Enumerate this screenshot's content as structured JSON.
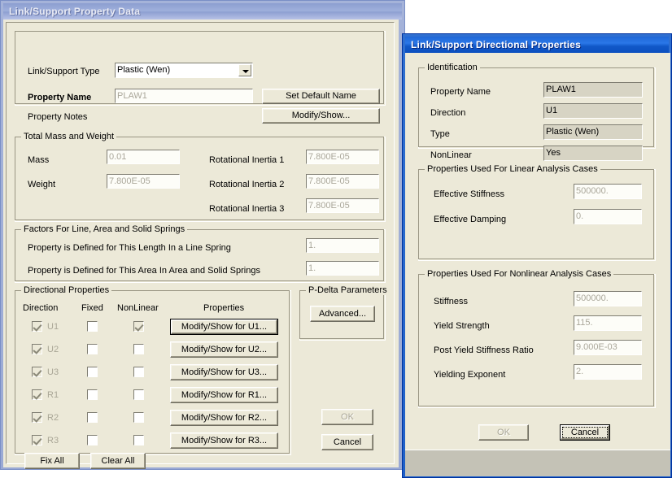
{
  "window_property_data": {
    "title": "Link/Support Property Data",
    "link_support_type": {
      "label": "Link/Support Type",
      "value": "Plastic (Wen)"
    },
    "property_name": {
      "label": "Property Name",
      "value": "PLAW1"
    },
    "property_notes": {
      "label": "Property Notes"
    },
    "set_default_name_button": "Set Default Name",
    "modify_show_notes_button": "Modify/Show...",
    "total_mass_and_weight": {
      "legend": "Total Mass and Weight",
      "mass": {
        "label": "Mass",
        "value": "0.01"
      },
      "weight": {
        "label": "Weight",
        "value": "7.800E-05"
      },
      "rotational_inertia_1": {
        "label": "Rotational Inertia 1",
        "value": "7.800E-05"
      },
      "rotational_inertia_2": {
        "label": "Rotational Inertia 2",
        "value": "7.800E-05"
      },
      "rotational_inertia_3": {
        "label": "Rotational Inertia 3",
        "value": "7.800E-05"
      }
    },
    "factors": {
      "legend": "Factors For Line, Area and Solid Springs",
      "line_spring": {
        "label": "Property is Defined for This Length In a Line Spring",
        "value": "1."
      },
      "area_solid_spring": {
        "label": "Property is Defined for This Area In Area and Solid Springs",
        "value": "1."
      }
    },
    "directional_properties": {
      "legend": "Directional Properties",
      "headers": {
        "direction": "Direction",
        "fixed": "Fixed",
        "nonlinear": "NonLinear",
        "properties": "Properties"
      },
      "rows": [
        {
          "direction": "U1",
          "direction_checked": true,
          "fixed_checked": false,
          "nonlinear_checked": true,
          "button": "Modify/Show for U1..."
        },
        {
          "direction": "U2",
          "direction_checked": true,
          "fixed_checked": false,
          "nonlinear_checked": false,
          "button": "Modify/Show for U2..."
        },
        {
          "direction": "U3",
          "direction_checked": true,
          "fixed_checked": false,
          "nonlinear_checked": false,
          "button": "Modify/Show for U3..."
        },
        {
          "direction": "R1",
          "direction_checked": true,
          "fixed_checked": false,
          "nonlinear_checked": false,
          "button": "Modify/Show for R1..."
        },
        {
          "direction": "R2",
          "direction_checked": true,
          "fixed_checked": false,
          "nonlinear_checked": false,
          "button": "Modify/Show for R2..."
        },
        {
          "direction": "R3",
          "direction_checked": true,
          "fixed_checked": false,
          "nonlinear_checked": false,
          "button": "Modify/Show for R3..."
        }
      ],
      "fix_all_button": "Fix All",
      "clear_all_button": "Clear All"
    },
    "p_delta": {
      "legend": "P-Delta Parameters",
      "advanced_button": "Advanced..."
    },
    "ok_button": "OK",
    "cancel_button": "Cancel"
  },
  "window_directional_properties": {
    "title": "Link/Support Directional Properties",
    "identification": {
      "legend": "Identification",
      "property_name": {
        "label": "Property Name",
        "value": "PLAW1"
      },
      "direction": {
        "label": "Direction",
        "value": "U1"
      },
      "type": {
        "label": "Type",
        "value": "Plastic (Wen)"
      },
      "nonlinear": {
        "label": "NonLinear",
        "value": "Yes"
      }
    },
    "linear_analysis": {
      "legend": "Properties Used For Linear Analysis Cases",
      "effective_stiffness": {
        "label": "Effective Stiffness",
        "value": "500000."
      },
      "effective_damping": {
        "label": "Effective Damping",
        "value": "0."
      }
    },
    "nonlinear_analysis": {
      "legend": "Properties Used For Nonlinear Analysis Cases",
      "stiffness": {
        "label": "Stiffness",
        "value": "500000."
      },
      "yield_strength": {
        "label": "Yield Strength",
        "value": "115."
      },
      "post_yield_stiffness_ratio": {
        "label": "Post Yield Stiffness Ratio",
        "value": "9.000E-03"
      },
      "yielding_exponent": {
        "label": "Yielding Exponent",
        "value": "2."
      }
    },
    "ok_button": "OK",
    "cancel_button": "Cancel"
  },
  "colors": {
    "dialog_face": "#ece9d8",
    "active_title": "#1f67d6",
    "inactive_title": "#9fb0dc",
    "disabled_text": "#aaa79a",
    "readonly_field": "#d7d4c4"
  }
}
